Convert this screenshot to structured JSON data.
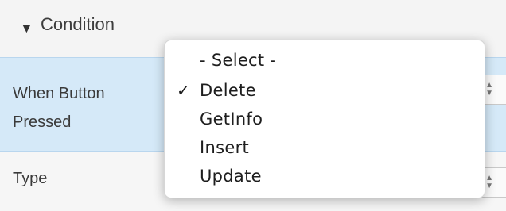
{
  "section": {
    "title": "Condition",
    "toggle_icon": "triangle-down-icon"
  },
  "rows": [
    {
      "label": "When Button Pressed",
      "selected_value": "Delete",
      "highlighted": true
    },
    {
      "label": "Type",
      "selected_value": ""
    }
  ],
  "dropdown": {
    "items": [
      {
        "label": "- Select -",
        "checked": false
      },
      {
        "label": "Delete",
        "checked": true
      },
      {
        "label": "GetInfo",
        "checked": false
      },
      {
        "label": "Insert",
        "checked": false
      },
      {
        "label": "Update",
        "checked": false
      }
    ],
    "check_glyph": "✓",
    "check_icon": "checkmark-icon"
  },
  "colors": {
    "row_highlight": "#d5e9f8",
    "menu_background": "#ffffff"
  }
}
